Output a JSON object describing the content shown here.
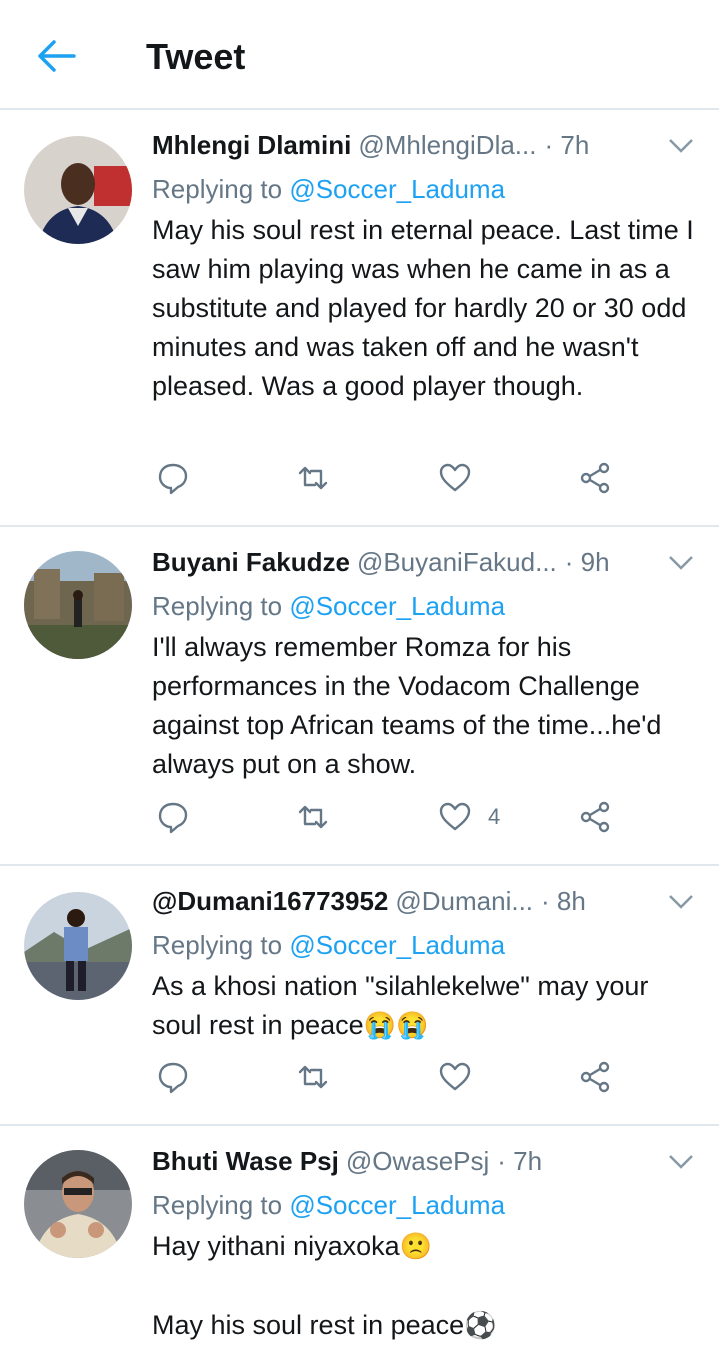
{
  "header": {
    "title": "Tweet"
  },
  "colors": {
    "accent": "#1da1f2",
    "secondary_text": "#657786",
    "divider": "#e1e8ed"
  },
  "tweets": [
    {
      "name": "Mhlengi Dlamini",
      "handle": "@MhlengiDla...",
      "time": "· 7h",
      "replying_prefix": "Replying to ",
      "replying_to": "@Soccer_Laduma",
      "text": "May his soul rest in eternal peace. Last time I saw him playing was when he came in as a substitute and played for hardly 20 or 30 odd minutes and was taken off and he wasn't pleased. Was a good player though.",
      "emoji": "",
      "like_count": ""
    },
    {
      "name": "Buyani Fakudze",
      "handle": "@BuyaniFakud...",
      "time": "· 9h",
      "replying_prefix": "Replying to ",
      "replying_to": "@Soccer_Laduma",
      "text": "I'll always remember Romza for his performances in the Vodacom Challenge against top African teams of the time...he'd always put on a show.",
      "emoji": "",
      "like_count": "4"
    },
    {
      "name": "@Dumani16773952",
      "handle": "@Dumani...",
      "time": "· 8h",
      "replying_prefix": "Replying to ",
      "replying_to": "@Soccer_Laduma",
      "text": "As a khosi nation \"silahlekelwe\" may your soul rest in peace",
      "emoji": "😭😭",
      "like_count": ""
    },
    {
      "name": "Bhuti Wase Psj",
      "handle": "@OwasePsj",
      "time": "· 7h",
      "replying_prefix": "Replying to ",
      "replying_to": "@Soccer_Laduma",
      "text": "Hay yithani niyaxoka",
      "emoji": "🙁",
      "text2": "May his soul rest in peace",
      "emoji2": "⚽",
      "like_count": ""
    }
  ]
}
